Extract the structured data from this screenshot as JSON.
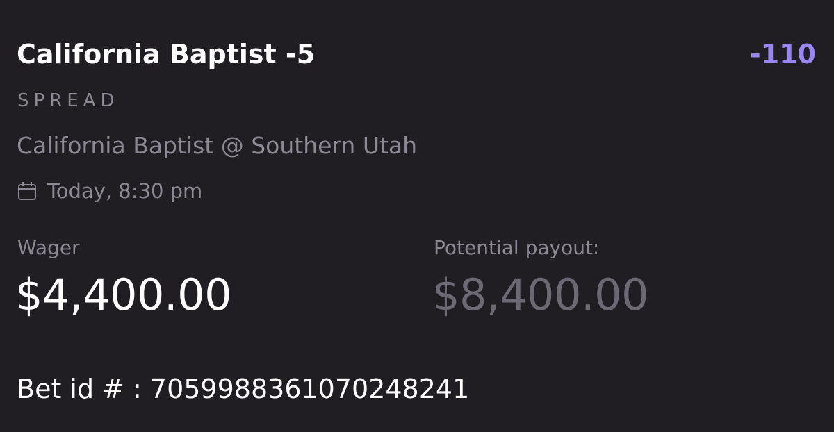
{
  "bet": {
    "title": "California Baptist -5",
    "odds": "-110",
    "type": "SPREAD",
    "matchup": "California Baptist @ Southern Utah",
    "event_time": "Today, 8:30 pm",
    "calendar_icon": "calendar-icon"
  },
  "wager": {
    "label": "Wager",
    "amount": "$4,400.00"
  },
  "payout": {
    "label": "Potential payout:",
    "amount": "$8,400.00"
  },
  "bet_id": {
    "label": "Bet id # :",
    "value": "705998836107024824​1"
  },
  "colors": {
    "background": "#201e23",
    "odds_accent": "#9a86f2",
    "muted_text": "#8c8994",
    "payout_text": "#6c6975",
    "primary_text": "#ffffff"
  }
}
